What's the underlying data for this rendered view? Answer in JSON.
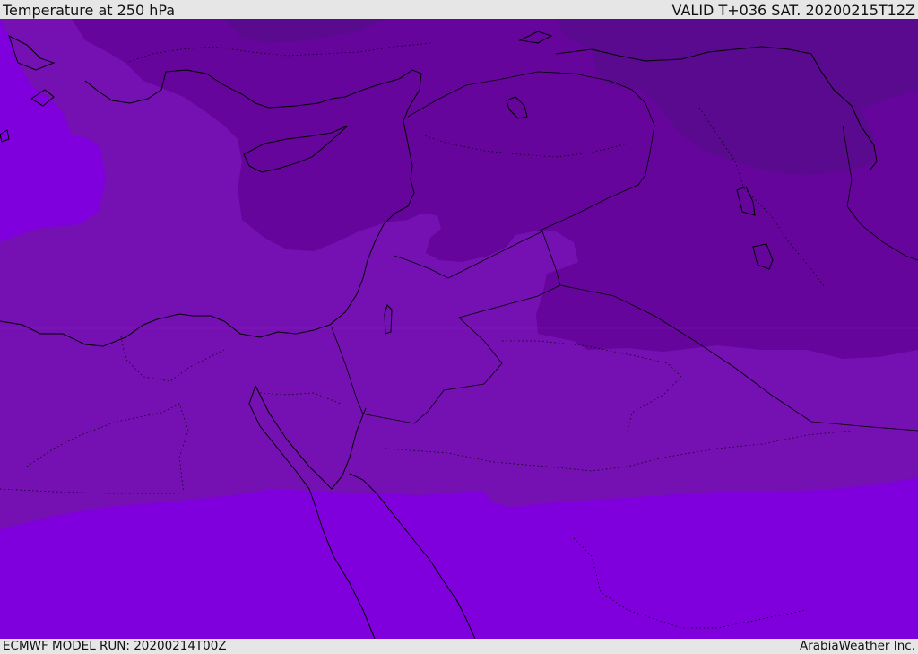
{
  "header": {
    "title": "Temperature at 250 hPa",
    "valid_time": "VALID T+036 SAT. 20200215T12Z"
  },
  "footer": {
    "model_run": "ECMWF MODEL RUN: 20200214T00Z",
    "credit": "ArabiaWeather Inc."
  },
  "map": {
    "region": "Eastern Mediterranean and Middle East",
    "colors": {
      "coldest": "#5a0a8e",
      "colder": "#65059c",
      "mid": "#7510b2",
      "warm": "#7f00dd",
      "coastline": "#000000"
    }
  }
}
